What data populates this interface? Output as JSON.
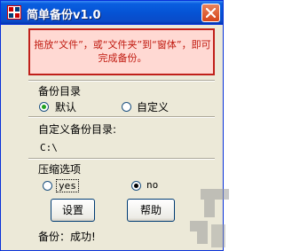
{
  "window": {
    "title": "简单备份v1.0",
    "app_icon": "app-icon",
    "close_icon": "close-icon"
  },
  "drop_panel": {
    "text": "拖放“文件”，或“文件夹”到“窗体”，即可完成备份。"
  },
  "backup_dir": {
    "heading": "备份目录",
    "options": [
      {
        "label": "默认",
        "selected": true
      },
      {
        "label": "自定义",
        "selected": false
      }
    ],
    "custom_label": "自定义备份目录:",
    "path": "C:\\"
  },
  "compression": {
    "heading": "压缩选项",
    "options": [
      {
        "label": "yes",
        "selected": false
      },
      {
        "label": "no",
        "selected": true
      }
    ]
  },
  "buttons": {
    "settings": "设置",
    "help": "帮助"
  },
  "status": {
    "text": "备份：成功!"
  },
  "colors": {
    "titlebar": "#0553d5",
    "drop_panel_border": "#c0201a",
    "drop_panel_fill": "#ffd9d3",
    "drop_panel_text": "#c01a10",
    "window_bg": "#ece9d8",
    "radio_selected": "#21a121"
  }
}
